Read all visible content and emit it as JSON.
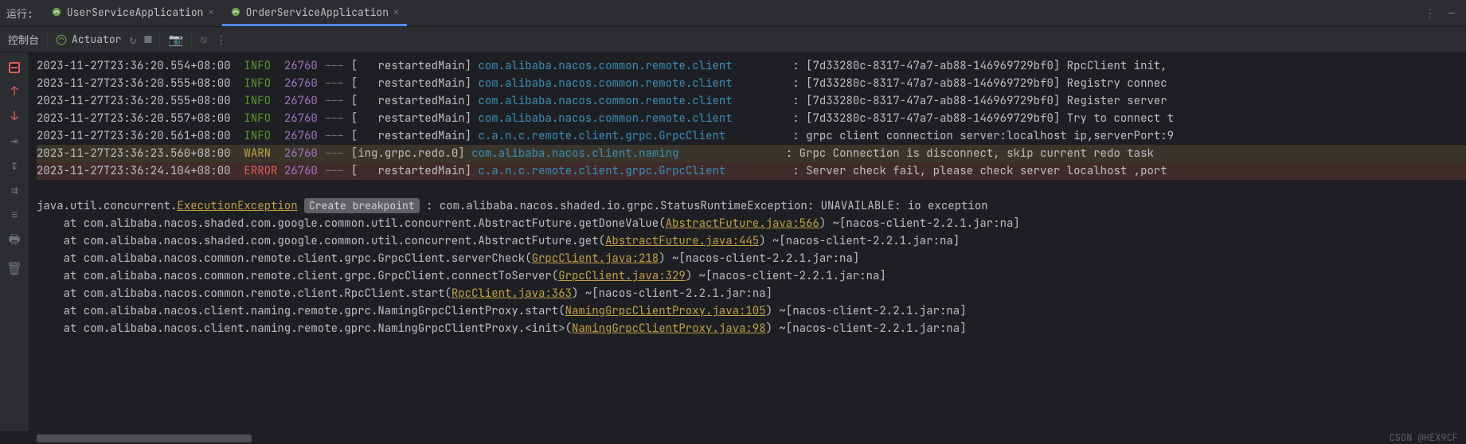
{
  "header": {
    "run_label": "运行:",
    "tabs": [
      {
        "label": "UserServiceApplication",
        "active": false
      },
      {
        "label": "OrderServiceApplication",
        "active": true
      }
    ]
  },
  "toolbar": {
    "console_tab": "控制台",
    "actuator": "Actuator"
  },
  "logs": [
    {
      "ts": "2023-11-27T23:36:20.554+08:00",
      "lvl": "INFO",
      "pid": "26760",
      "thread": "   restartedMain",
      "logger": "com.alibaba.nacos.common.remote.client        ",
      "msg": ": [7d33280c-8317-47a7-ab88-146969729bf0] RpcClient init,"
    },
    {
      "ts": "2023-11-27T23:36:20.555+08:00",
      "lvl": "INFO",
      "pid": "26760",
      "thread": "   restartedMain",
      "logger": "com.alibaba.nacos.common.remote.client        ",
      "msg": ": [7d33280c-8317-47a7-ab88-146969729bf0] Registry connec"
    },
    {
      "ts": "2023-11-27T23:36:20.555+08:00",
      "lvl": "INFO",
      "pid": "26760",
      "thread": "   restartedMain",
      "logger": "com.alibaba.nacos.common.remote.client        ",
      "msg": ": [7d33280c-8317-47a7-ab88-146969729bf0] Register server"
    },
    {
      "ts": "2023-11-27T23:36:20.557+08:00",
      "lvl": "INFO",
      "pid": "26760",
      "thread": "   restartedMain",
      "logger": "com.alibaba.nacos.common.remote.client        ",
      "msg": ": [7d33280c-8317-47a7-ab88-146969729bf0] Try to connect t"
    },
    {
      "ts": "2023-11-27T23:36:20.561+08:00",
      "lvl": "INFO",
      "pid": "26760",
      "thread": "   restartedMain",
      "logger": "c.a.n.c.remote.client.grpc.GrpcClient         ",
      "msg": ": grpc client connection server:localhost ip,serverPort:9"
    },
    {
      "ts": "2023-11-27T23:36:23.560+08:00",
      "lvl": "WARN",
      "pid": "26760",
      "thread": "ing.grpc.redo.0",
      "logger": "com.alibaba.nacos.client.naming               ",
      "msg": ": Grpc Connection is disconnect, skip current redo task ",
      "hl": "warn"
    },
    {
      "ts": "2023-11-27T23:36:24.104+08:00",
      "lvl": "ERROR",
      "pid": "26760",
      "thread": "   restartedMain",
      "logger": "c.a.n.c.remote.client.grpc.GrpcClient         ",
      "msg": ": Server check fail, please check server localhost ,port",
      "hl": "error"
    }
  ],
  "exception": {
    "prefix": "java.util.concurrent.",
    "name": "ExecutionException",
    "chip": "Create breakpoint",
    "suffix": ": com.alibaba.nacos.shaded.io.grpc.StatusRuntimeException: UNAVAILABLE: io exception"
  },
  "stack": [
    {
      "pre": "    at com.alibaba.nacos.shaded.com.google.common.util.concurrent.AbstractFuture.getDoneValue(",
      "file": "AbstractFuture.java:566",
      "post": ") ~[nacos-client-2.2.1.jar:na]"
    },
    {
      "pre": "    at com.alibaba.nacos.shaded.com.google.common.util.concurrent.AbstractFuture.get(",
      "file": "AbstractFuture.java:445",
      "post": ") ~[nacos-client-2.2.1.jar:na]"
    },
    {
      "pre": "    at com.alibaba.nacos.common.remote.client.grpc.GrpcClient.serverCheck(",
      "file": "GrpcClient.java:218",
      "post": ") ~[nacos-client-2.2.1.jar:na]"
    },
    {
      "pre": "    at com.alibaba.nacos.common.remote.client.grpc.GrpcClient.connectToServer(",
      "file": "GrpcClient.java:329",
      "post": ") ~[nacos-client-2.2.1.jar:na]"
    },
    {
      "pre": "    at com.alibaba.nacos.common.remote.client.RpcClient.start(",
      "file": "RpcClient.java:363",
      "post": ") ~[nacos-client-2.2.1.jar:na]"
    },
    {
      "pre": "    at com.alibaba.nacos.client.naming.remote.gprc.NamingGrpcClientProxy.start(",
      "file": "NamingGrpcClientProxy.java:105",
      "post": ") ~[nacos-client-2.2.1.jar:na]"
    },
    {
      "pre": "    at com.alibaba.nacos.client.naming.remote.gprc.NamingGrpcClientProxy.<init>(",
      "file": "NamingGrpcClientProxy.java:98",
      "post": ") ~[nacos-client-2.2.1.jar:na]"
    }
  ],
  "footer": "CSDN @HEX9CF"
}
